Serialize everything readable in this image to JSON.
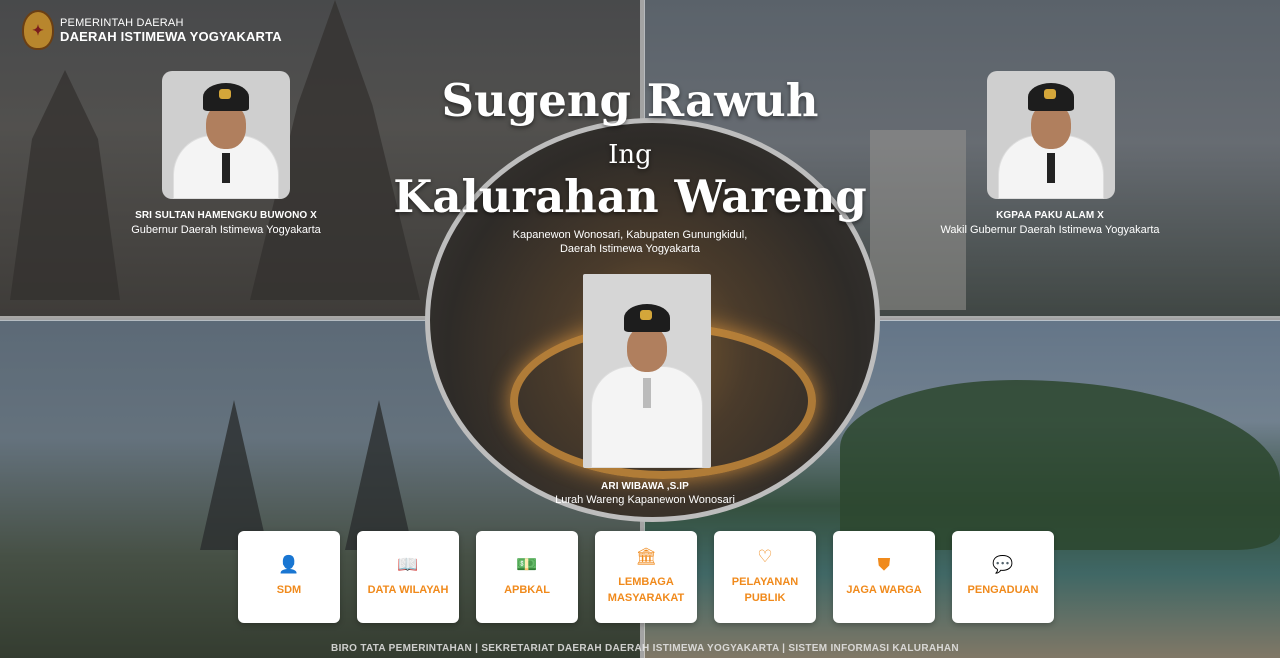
{
  "header": {
    "logo_line1": "PEMERINTAH DAERAH",
    "logo_line2": "DAERAH ISTIMEWA YOGYAKARTA",
    "crest_icon": "crest-icon"
  },
  "hero": {
    "title_line1": "Sugeng Rawuh",
    "title_line2": "Ing",
    "title_line3": "Kalurahan Wareng",
    "location_line1": "Kapanewon Wonosari, Kabupaten Gunungkidul,",
    "location_line2": "Daerah Istimewa Yogyakarta"
  },
  "officials": {
    "governor": {
      "name": "SRI SULTAN HAMENGKU BUWONO X",
      "role": "Gubernur Daerah Istimewa Yogyakarta"
    },
    "vice_governor": {
      "name": "KGPAA PAKU ALAM X",
      "role": "Wakil Gubernur Daerah Istimewa Yogyakarta"
    },
    "lurah": {
      "name": "ARI WIBAWA ,S.IP",
      "role": "Lurah Wareng Kapanewon Wonosari"
    }
  },
  "menu": [
    {
      "label": "SDM",
      "icon": "user-icon",
      "glyph": "👤"
    },
    {
      "label": "DATA WILAYAH",
      "icon": "book-icon",
      "glyph": "📖"
    },
    {
      "label": "APBKAL",
      "icon": "money-icon",
      "glyph": "💵"
    },
    {
      "label": "LEMBAGA MASYARAKAT",
      "icon": "institution-icon",
      "glyph": "🏛"
    },
    {
      "label": "PELAYANAN PUBLIK",
      "icon": "heart-hand-icon",
      "glyph": "♡"
    },
    {
      "label": "JAGA WARGA",
      "icon": "shield-icon",
      "glyph": "⛊"
    },
    {
      "label": "PENGADUAN",
      "icon": "chat-icon",
      "glyph": "💬"
    }
  ],
  "footer": {
    "text": "BIRO TATA PEMERINTAHAN | SEKRETARIAT DAERAH DAERAH ISTIMEWA YOGYAKARTA | SISTEM INFORMASI KALURAHAN"
  },
  "colors": {
    "accent": "#f08a1c",
    "card_bg": "#ffffff",
    "text_light": "#ffffff"
  }
}
